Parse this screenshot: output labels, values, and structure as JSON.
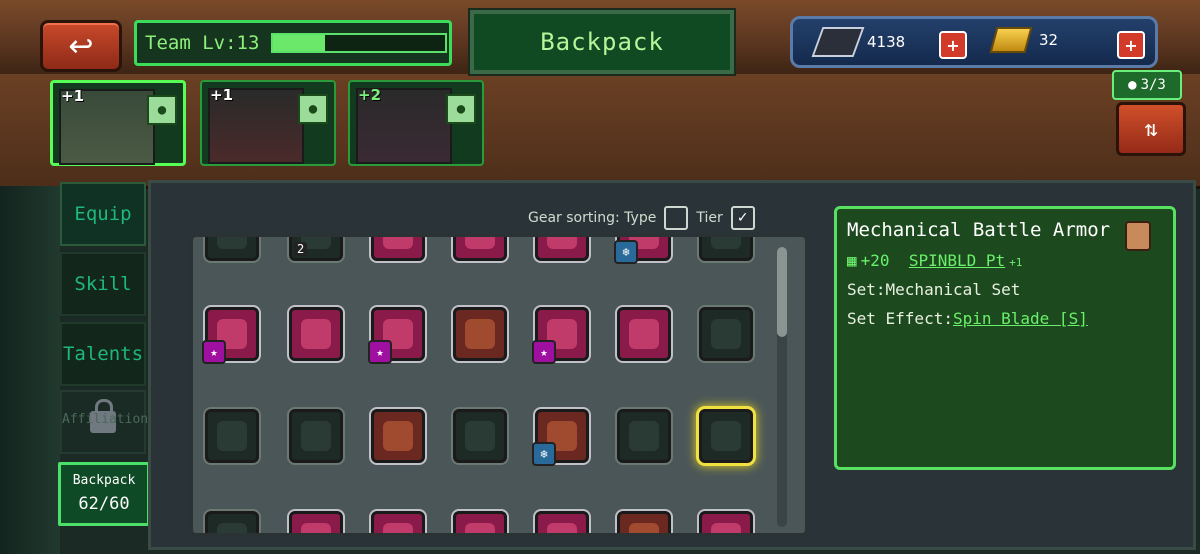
{
  "header": {
    "back_label": "↩",
    "team_label": "Team Lv:13",
    "team_progress": 0.3,
    "title": "Backpack"
  },
  "resources": {
    "gems": "4138",
    "gold": "32",
    "plus": "+"
  },
  "heroes": [
    {
      "badge": "+1",
      "active": true
    },
    {
      "badge": "+1",
      "active": false
    },
    {
      "badge": "+2",
      "active": false
    }
  ],
  "squad": {
    "count": "3/3"
  },
  "tabs": {
    "equip": "Equip",
    "skill": "Skill",
    "talents": "Talents",
    "affiliation": "Affiliation"
  },
  "backpack": {
    "label": "Backpack",
    "count": "62/60"
  },
  "sorting": {
    "label": "Gear sorting:",
    "type": "Type",
    "tier": "Tier",
    "tier_checked": true,
    "type_checked": false
  },
  "grid_top_row_count": "2",
  "detail": {
    "name": "Mechanical Battle Armor",
    "stat_value": "+20",
    "stat_link": "SPINBLD Pt",
    "stat_sub": "+1",
    "set_label": "Set:Mechanical Set",
    "effect_label": "Set Effect:",
    "effect_link": "Spin Blade [S]"
  },
  "colors": {
    "accent_green": "#58e060",
    "rare_pink": "#8a1a4a",
    "select_yellow": "#f0e040"
  }
}
